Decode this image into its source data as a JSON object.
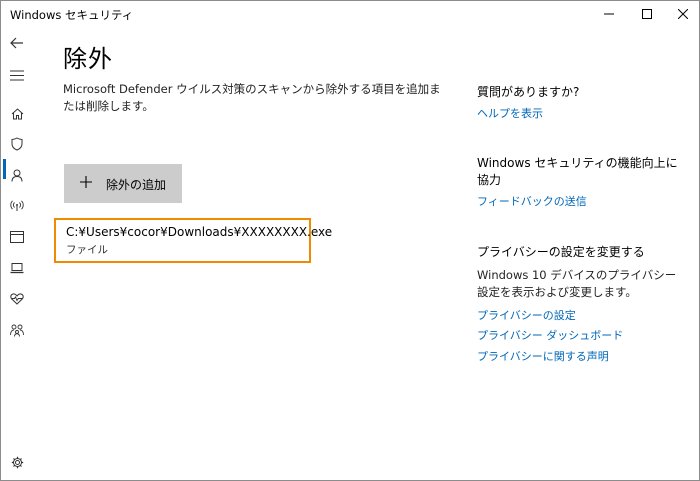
{
  "window": {
    "title": "Windows セキュリティ"
  },
  "sidebar": {
    "items": [
      {
        "name": "back",
        "icon": "back-arrow-icon"
      },
      {
        "name": "menu",
        "icon": "hamburger-icon"
      },
      {
        "name": "home",
        "icon": "home-icon"
      },
      {
        "name": "virus-protection",
        "icon": "shield-icon",
        "active": true
      },
      {
        "name": "account-protection",
        "icon": "person-icon"
      },
      {
        "name": "firewall",
        "icon": "antenna-icon"
      },
      {
        "name": "app-browser-control",
        "icon": "browser-window-icon"
      },
      {
        "name": "device-security",
        "icon": "laptop-icon"
      },
      {
        "name": "device-performance",
        "icon": "heart-pulse-icon"
      },
      {
        "name": "family-options",
        "icon": "family-icon"
      },
      {
        "name": "settings",
        "icon": "gear-icon"
      }
    ]
  },
  "main": {
    "title": "除外",
    "description": "Microsoft Defender ウイルス対策のスキャンから除外する項目を追加または削除します。",
    "add_button": "除外の追加",
    "exclusions": [
      {
        "path": "C:¥Users¥cocor¥Downloads¥XXXXXXXX.exe",
        "type": "ファイル"
      }
    ]
  },
  "right": {
    "help_heading": "質問がありますか?",
    "help_link": "ヘルプを表示",
    "feedback_heading": "Windows セキュリティの機能向上に協力",
    "feedback_link": "フィードバックの送信",
    "privacy_heading": "プライバシーの設定を変更する",
    "privacy_text": "Windows 10 デバイスのプライバシー設定を表示および変更します。",
    "privacy_links": [
      "プライバシーの設定",
      "プライバシー ダッシュボード",
      "プライバシーに関する声明"
    ]
  },
  "colors": {
    "accent": "#0067b8",
    "highlight_border": "#f08a00",
    "button_bg": "#cccccc"
  }
}
